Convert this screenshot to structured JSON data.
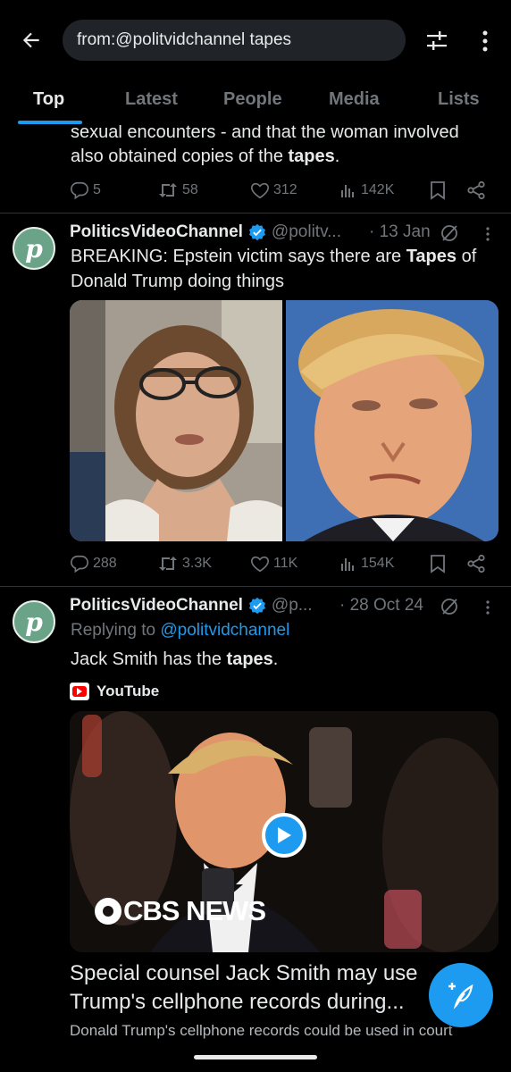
{
  "search": {
    "query": "from:@politvidchannel tapes"
  },
  "tabs": [
    {
      "label": "Top",
      "active": true
    },
    {
      "label": "Latest",
      "active": false
    },
    {
      "label": "People",
      "active": false
    },
    {
      "label": "Media",
      "active": false
    },
    {
      "label": "Lists",
      "active": false
    }
  ],
  "tweet0": {
    "text_line1": "sexual encounters - and that the woman involved",
    "text_line2_prefix": "also obtained copies of the ",
    "text_line2_bold": "tapes",
    "text_line2_suffix": ".",
    "replies": "5",
    "reposts": "58",
    "likes": "312",
    "views": "142K"
  },
  "tweet1": {
    "name": "PoliticsVideoChannel",
    "handle": "@politv...",
    "date": "· 13 Jan",
    "text_line1_prefix": "BREAKING: Epstein victim says there are ",
    "text_line1_bold": "Tapes",
    "text_line1_suffix": " of",
    "text_line2": "Donald Trump doing things",
    "replies": "288",
    "reposts": "3.3K",
    "likes": "11K",
    "views": "154K"
  },
  "tweet2": {
    "name": "PoliticsVideoChannel",
    "handle": "@p...",
    "date": "· 28 Oct 24",
    "replying_prefix": "Replying to ",
    "replying_handle": "@politvidchannel",
    "text_prefix": "Jack Smith has the ",
    "text_bold": "tapes",
    "text_suffix": ".",
    "source": "YouTube",
    "video_brand": "CBS NEWS",
    "card_title_line1": "Special counsel Jack Smith may use",
    "card_title_line2": "Trump's cellphone records during...",
    "card_subtitle": "Donald Trump's cellphone records could be used in court"
  },
  "avatar_letter": "p",
  "colors": {
    "accent": "#1d9bf0",
    "background": "#000000",
    "muted": "#71767b",
    "avatar": "#6aa388"
  }
}
